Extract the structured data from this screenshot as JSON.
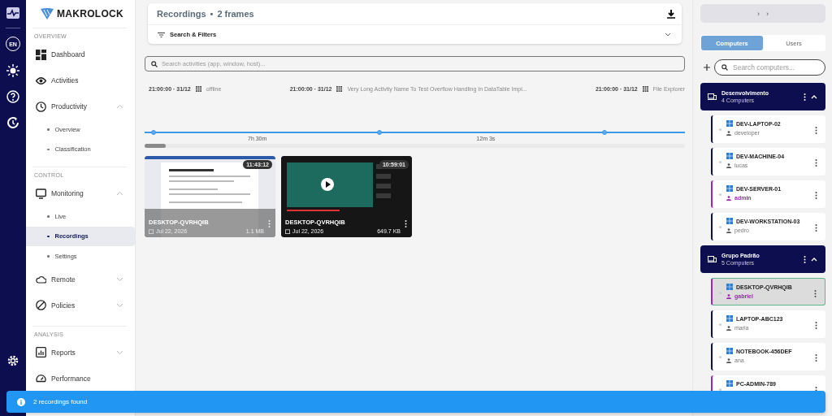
{
  "rail": {
    "language": "EN"
  },
  "sidebar": {
    "brand": "MAKROLOCK",
    "sections": [
      {
        "heading": "OVERVIEW",
        "items": [
          {
            "label": "Dashboard"
          },
          {
            "label": "Activities"
          },
          {
            "label": "Productivity",
            "expanded": true,
            "children": [
              {
                "label": "Overview",
                "selected": false
              },
              {
                "label": "Classification",
                "selected": false
              }
            ]
          }
        ]
      },
      {
        "heading": "CONTROL",
        "items": [
          {
            "label": "Monitoring",
            "expanded": true,
            "children": [
              {
                "label": "Live",
                "selected": false
              },
              {
                "label": "Recordings",
                "selected": true
              },
              {
                "label": "Settings",
                "selected": false
              }
            ]
          },
          {
            "label": "Remote",
            "expanded": false
          },
          {
            "label": "Policies",
            "expanded": false
          }
        ]
      },
      {
        "heading": "ANALYSIS",
        "items": [
          {
            "label": "Reports",
            "expanded": false
          },
          {
            "label": "Performance"
          }
        ]
      }
    ]
  },
  "header": {
    "title": "Recordings",
    "separator": "•",
    "count": "2 frames",
    "filters": {
      "label": "Search & Filters",
      "expanded": false
    }
  },
  "search": {
    "placeholder": "Search activities (app, window, host)..."
  },
  "timeline": {
    "events": [
      {
        "time": "21:00:00 · 31/12",
        "label": "offline"
      },
      {
        "time": "21:00:00 · 31/12",
        "label": "Very Long Activity Name To Test Overflow Handling In DataTable Impl..."
      },
      {
        "time": "21:00:00 · 31/12",
        "label": "File Explorer"
      }
    ],
    "durations": [
      "7h 30m",
      "12m 3s"
    ]
  },
  "recordings": [
    {
      "kind": "document",
      "time": "11:43:12",
      "host": "DESKTOP-QVRHQIB",
      "date": "Jul 22, 2026",
      "size": "1.1 MB"
    },
    {
      "kind": "video",
      "time": "10:59:01",
      "host": "DESKTOP-QVRHQIB",
      "date": "Jul 22, 2026",
      "size": "649.7 KB"
    }
  ],
  "panel": {
    "breadcrumb": [
      "›",
      "›"
    ],
    "tabs": [
      {
        "label": "Computers",
        "selected": true
      },
      {
        "label": "Users",
        "selected": false
      }
    ],
    "search": {
      "placeholder": "Search computers..."
    },
    "groups": [
      {
        "name": "Desenvolvimento",
        "count": "4 Computers",
        "expanded": true,
        "computers": [
          {
            "name": "DEV-LAPTOP-02",
            "user": "developer",
            "admin": false,
            "selected": false
          },
          {
            "name": "DEV-MACHINE-04",
            "user": "lucas",
            "admin": false,
            "selected": false
          },
          {
            "name": "DEV-SERVER-01",
            "user": "admin",
            "admin": true,
            "selected": false
          },
          {
            "name": "DEV-WORKSTATION-03",
            "user": "pedro",
            "admin": false,
            "selected": false
          }
        ]
      },
      {
        "name": "Grupo Padrão",
        "count": "5 Computers",
        "expanded": true,
        "computers": [
          {
            "name": "DESKTOP-QVRHQIB",
            "user": "gabriel",
            "admin": true,
            "selected": true
          },
          {
            "name": "LAPTOP-ABC123",
            "user": "maria",
            "admin": false,
            "selected": false
          },
          {
            "name": "NOTEBOOK-456DEF",
            "user": "ana",
            "admin": false,
            "selected": false
          },
          {
            "name": "PC-ADMIN-789",
            "admin": true,
            "selected": false
          }
        ]
      }
    ]
  },
  "toast": {
    "message": "2 recordings found"
  }
}
